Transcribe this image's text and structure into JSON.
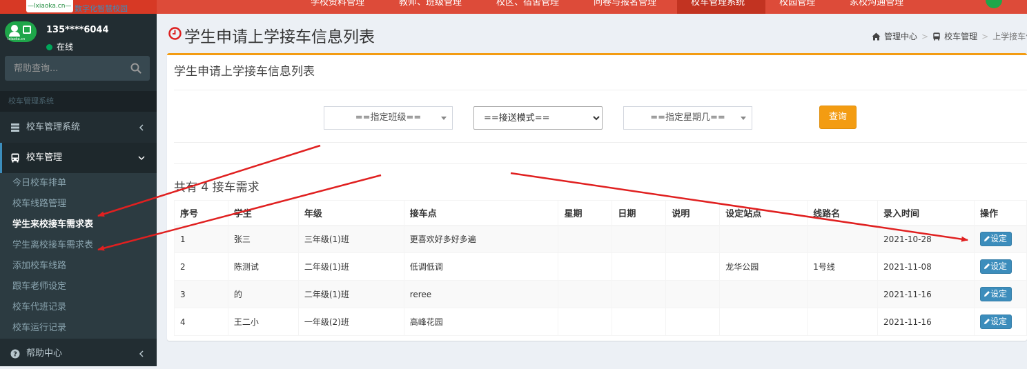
{
  "top": {
    "logo_text": "—lxiaoka.cn—",
    "tagline": "数字化智慧校园",
    "nav": [
      {
        "label": "学校资料管理"
      },
      {
        "label": "教师、班级管理"
      },
      {
        "label": "校区、宿舍管理"
      },
      {
        "label": "问卷与报名管理"
      },
      {
        "label": "校车管理系统"
      },
      {
        "label": "校园管理"
      },
      {
        "label": "家校沟通管理"
      }
    ]
  },
  "user": {
    "avatar_text": "lxiaoka.cn",
    "name": "135****6044",
    "status": "在线"
  },
  "search": {
    "placeholder": "帮助查询..."
  },
  "sidebar": {
    "header": "校车管理系统",
    "items": [
      {
        "label": "校车管理系统"
      },
      {
        "label": "校车管理"
      },
      {
        "label": "帮助中心"
      }
    ],
    "sub_items": [
      {
        "label": "今日校车排单"
      },
      {
        "label": "校车线路管理"
      },
      {
        "label": "学生来校接车需求表"
      },
      {
        "label": "学生离校接车需求表"
      },
      {
        "label": "添加校车线路"
      },
      {
        "label": "跟车老师设定"
      },
      {
        "label": "校车代班记录"
      },
      {
        "label": "校车运行记录"
      }
    ]
  },
  "page": {
    "title": "学生申请上学接车信息列表",
    "breadcrumb": [
      "管理中心",
      "校车管理",
      "上学接车信"
    ]
  },
  "box": {
    "title": "学生申请上学接车信息列表",
    "filters": {
      "class": "==指定班级==",
      "mode": "==接送模式==",
      "weekday": "==指定星期几=="
    },
    "query_label": "查询",
    "count_text": "共有 4 接车需求"
  },
  "table": {
    "headers": [
      "序号",
      "学生",
      "年级",
      "接车点",
      "星期",
      "日期",
      "说明",
      "设定站点",
      "线路名",
      "录入时间",
      "操作"
    ],
    "rows": [
      [
        "1",
        "张三",
        "三年级(1)班",
        "更喜欢好多好多遍",
        "",
        "",
        "",
        "",
        "",
        "2021-10-28"
      ],
      [
        "2",
        "陈测试",
        "二年级(1)班",
        "低调低调",
        "",
        "",
        "",
        "龙华公园",
        "1号线",
        "2021-11-08"
      ],
      [
        "3",
        "的",
        "二年级(1)班",
        "reree",
        "",
        "",
        "",
        "",
        "",
        "2021-11-16"
      ],
      [
        "4",
        "王二小",
        "一年级(2)班",
        "高峰花园",
        "",
        "",
        "",
        "",
        "",
        "2021-11-16"
      ]
    ],
    "action_label": "设定"
  },
  "colors": {
    "top_bar": "#dd4b39",
    "sidebar": "#222d32",
    "box_accent": "#f39c12",
    "action_button": "#3c8dbc",
    "annotation_arrow": "#e02020"
  }
}
